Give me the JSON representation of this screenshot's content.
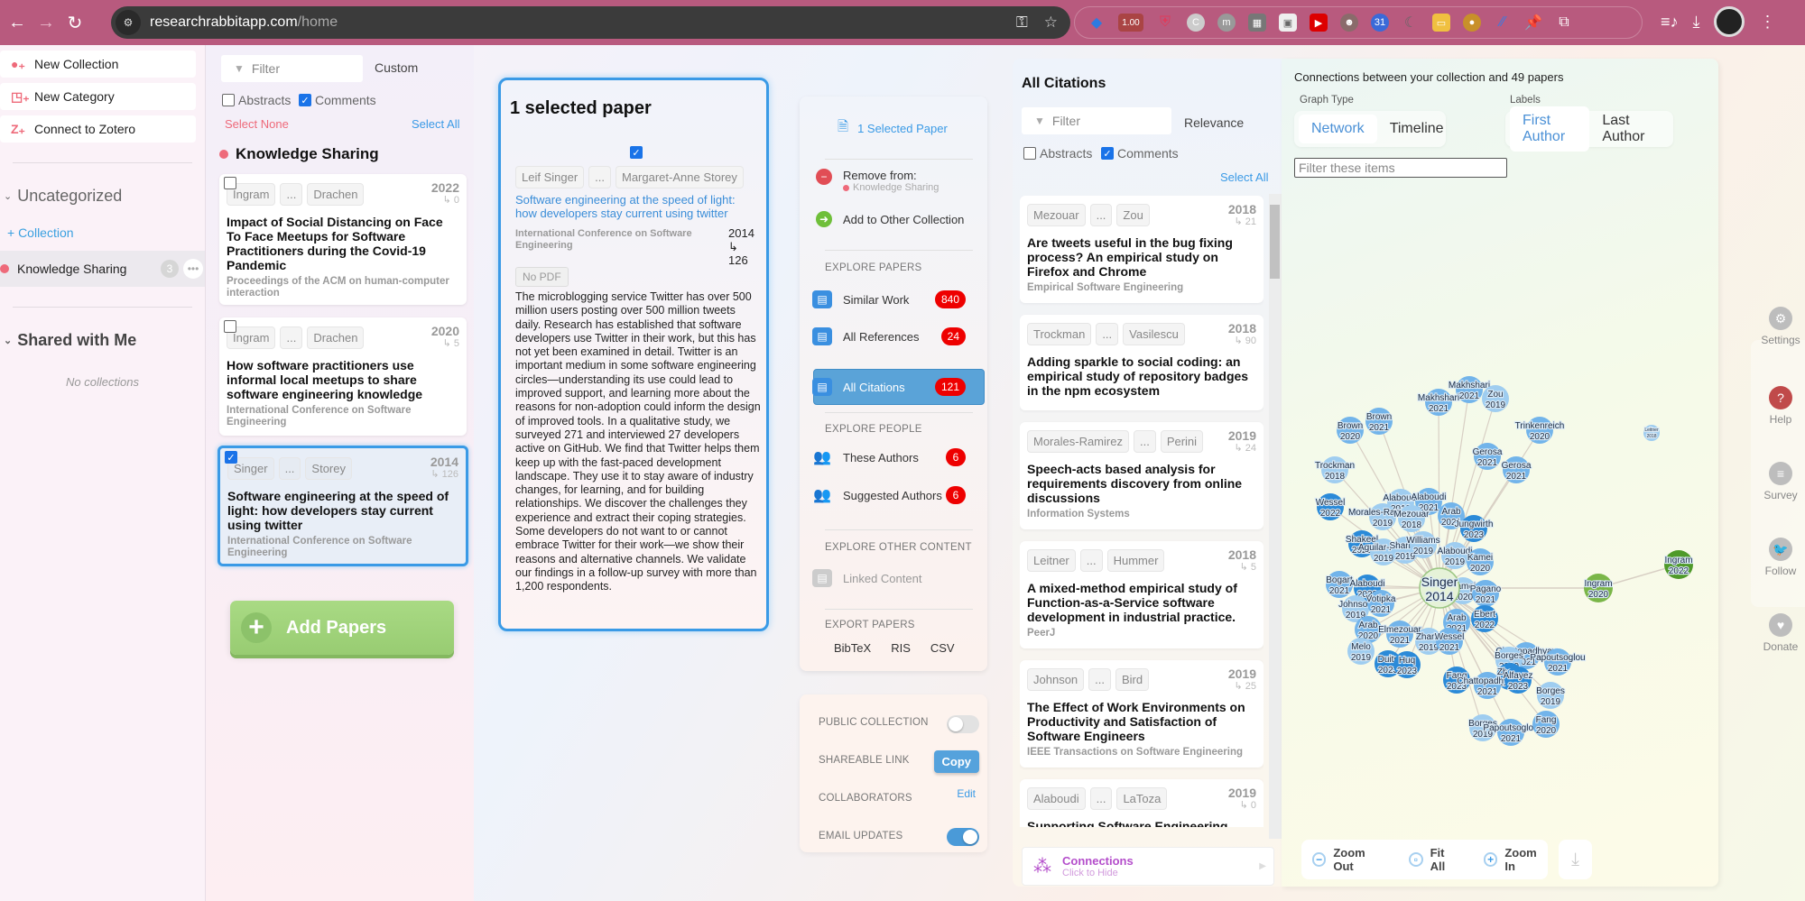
{
  "browser": {
    "url_domain": "researchrabbitapp.com",
    "url_path": "/home",
    "extension_badge": "1.00",
    "extensions": [
      "gem-icon",
      "zoom-badge-icon",
      "shield-icon",
      "c-icon",
      "m-icon",
      "puzzle-icon",
      "window-icon",
      "video-icon",
      "gorilla-icon",
      "calendar-31-icon",
      "moon-icon",
      "folder-icon",
      "cookie-icon",
      "ai-icon",
      "pin-icon",
      "extensions-icon"
    ]
  },
  "sidebar": {
    "actions": [
      {
        "label": "New Collection",
        "icon": "new-collection-icon"
      },
      {
        "label": "New Category",
        "icon": "new-category-icon"
      },
      {
        "label": "Connect to Zotero",
        "icon": "zotero-icon"
      }
    ],
    "section_uncategorized": "Uncategorized",
    "add_collection": "+ Collection",
    "collection": {
      "name": "Knowledge Sharing",
      "count": "3",
      "color": "#ee6a7a"
    },
    "section_shared": "Shared with Me",
    "shared_empty": "No collections"
  },
  "collection_column": {
    "filter_placeholder": "Filter",
    "sort": "Custom",
    "abstracts_label": "Abstracts",
    "abstracts_checked": false,
    "comments_label": "Comments",
    "comments_checked": true,
    "select_none": "Select None",
    "select_all": "Select All",
    "title": "Knowledge Sharing",
    "papers": [
      {
        "first_author": "Ingram",
        "last_author": "Drachen",
        "year": "2022",
        "citations": "↳ 0",
        "title": "Impact of Social Distancing on Face To Face Meetups for Software Practitioners during the Covid-19 Pandemic",
        "venue": "Proceedings of the ACM on human-computer interaction",
        "selected": false
      },
      {
        "first_author": "Ingram",
        "last_author": "Drachen",
        "year": "2020",
        "citations": "↳ 5",
        "title": "How software practitioners use informal local meetups to share software engineering knowledge",
        "venue": "International Conference on Software Engineering",
        "selected": false
      },
      {
        "first_author": "Singer",
        "last_author": "Storey",
        "year": "2014",
        "citations": "↳ 126",
        "title": "Software engineering at the speed of light: how developers stay current using twitter",
        "venue": "International Conference on Software Engineering",
        "selected": true
      }
    ],
    "add_papers": "Add Papers"
  },
  "selected_paper": {
    "heading": "1 selected paper",
    "first_author": "Leif Singer",
    "ellipsis": "...",
    "last_author": "Margaret-Anne Storey",
    "title": "Software engineering at the speed of light: how developers stay current using twitter",
    "venue": "International Conference on Software Engineering",
    "year": "2014",
    "cite_arrow": "↳",
    "citations": "126",
    "pdf": "No PDF",
    "abstract": "The microblogging service Twitter has over 500 million users posting over 500 million tweets daily. Research has established that software developers use Twitter in their work, but this has not yet been examined in detail. Twitter is an important medium in some software engineering circles—understanding its use could lead to improved support, and learning more about the reasons for non-adoption could inform the design of improved tools. In a qualitative study, we surveyed 271 and interviewed 27 developers active on GitHub. We find that Twitter helps them keep up with the fast-paced development landscape. They use it to stay aware of industry changes, for learning, and for building relationships. We discover the challenges they experience and extract their coping strategies. Some developers do not want to or cannot embrace Twitter for their work—we show their reasons and alternative channels. We validate our findings in a follow-up survey with more than 1,200 respondents."
  },
  "action_menu": {
    "selected": "1 Selected Paper",
    "remove_from": "Remove from:",
    "remove_collection": "Knowledge Sharing",
    "add_other": "Add to Other Collection",
    "explore_papers": "EXPLORE PAPERS",
    "similar_work": {
      "label": "Similar Work",
      "count": "840"
    },
    "all_references": {
      "label": "All References",
      "count": "24"
    },
    "all_citations": {
      "label": "All Citations",
      "count": "121"
    },
    "explore_people": "EXPLORE PEOPLE",
    "these_authors": {
      "label": "These Authors",
      "count": "6"
    },
    "suggested_authors": {
      "label": "Suggested Authors",
      "count": "6"
    },
    "explore_other": "EXPLORE OTHER CONTENT",
    "linked_content": "Linked Content",
    "export_papers": "EXPORT PAPERS",
    "export_formats": [
      "BibTeX",
      "RIS",
      "CSV"
    ]
  },
  "collection_settings": {
    "public_collection": "PUBLIC COLLECTION",
    "public_on": false,
    "shareable_link": "SHAREABLE LINK",
    "copy": "Copy",
    "collaborators": "COLLABORATORS",
    "edit": "Edit",
    "email_updates": "EMAIL UPDATES",
    "email_on": true
  },
  "citations": {
    "heading": "All Citations",
    "filter_placeholder": "Filter",
    "sort": "Relevance",
    "abstracts_label": "Abstracts",
    "comments_label": "Comments",
    "select_all": "Select All",
    "papers": [
      {
        "first_author": "Mezouar",
        "last_author": "Zou",
        "year": "2018",
        "citations": "↳ 21",
        "title": "Are tweets useful in the bug fixing process? An empirical study on Firefox and Chrome",
        "venue": "Empirical Software Engineering"
      },
      {
        "first_author": "Trockman",
        "last_author": "Vasilescu",
        "year": "2018",
        "citations": "↳ 90",
        "title": "Adding sparkle to social coding: an empirical study of repository badges in the npm ecosystem",
        "venue": ""
      },
      {
        "first_author": "Morales-Ramirez",
        "last_author": "Perini",
        "year": "2019",
        "citations": "↳ 24",
        "title": "Speech-acts based analysis for requirements discovery from online discussions",
        "venue": "Information Systems"
      },
      {
        "first_author": "Leitner",
        "last_author": "Hummer",
        "year": "2018",
        "citations": "↳ 5",
        "title": "A mixed-method empirical study of Function-as-a-Service software development in industrial practice.",
        "venue": "PeerJ"
      },
      {
        "first_author": "Johnson",
        "last_author": "Bird",
        "year": "2019",
        "citations": "↳ 25",
        "title": "The Effect of Work Environments on Productivity and Satisfaction of Software Engineers",
        "venue": "IEEE Transactions on Software Engineering"
      },
      {
        "first_author": "Alaboudi",
        "last_author": "LaToza",
        "year": "2019",
        "citations": "↳ 0",
        "title": "Supporting Software Engineering Research and Education by",
        "venue": ""
      }
    ],
    "connections_title": "Connections",
    "connections_sub": "Click to Hide"
  },
  "graph": {
    "title": "Connections between your collection and 49 papers",
    "graph_type_label": "Graph Type",
    "graph_types": [
      "Network",
      "Timeline"
    ],
    "graph_type_active": "Network",
    "labels_label": "Labels",
    "label_types": [
      "First Author",
      "Last Author"
    ],
    "label_active": "First Author",
    "filter_placeholder": "Filter these items",
    "zoom_out": "Zoom Out",
    "fit_all": "Fit All",
    "zoom_in": "Zoom In",
    "center": {
      "name": "Singer",
      "year": "2014"
    },
    "nodes": [
      {
        "name": "Makhshari",
        "year": "2021",
        "shade": 1
      },
      {
        "name": "Makhshari",
        "year": "2021",
        "shade": 1
      },
      {
        "name": "Zou",
        "year": "2019",
        "shade": 0
      },
      {
        "name": "Brown",
        "year": "2021",
        "shade": 1
      },
      {
        "name": "Brown",
        "year": "2020",
        "shade": 1
      },
      {
        "name": "Trinkenreich",
        "year": "2020",
        "shade": 1
      },
      {
        "name": "Gerosa",
        "year": "2021",
        "shade": 1
      },
      {
        "name": "Gerosa",
        "year": "2021",
        "shade": 1
      },
      {
        "name": "Trockman",
        "year": "2018",
        "shade": 0
      },
      {
        "name": "Wessel",
        "year": "2022",
        "shade": 2
      },
      {
        "name": "Alaboudi",
        "year": "2019",
        "shade": 0
      },
      {
        "name": "Alaboudi",
        "year": "2021",
        "shade": 1
      },
      {
        "name": "Morales-Ramirez",
        "year": "2019",
        "shade": 0
      },
      {
        "name": "Mezouar",
        "year": "2018",
        "shade": 0
      },
      {
        "name": "Arab",
        "year": "2021",
        "shade": 1
      },
      {
        "name": "Jungwirth",
        "year": "2023",
        "shade": 2
      },
      {
        "name": "Shakeel",
        "year": "2022",
        "shade": 2
      },
      {
        "name": "Aguilar-Avila",
        "year": "2019",
        "shade": 0
      },
      {
        "name": "Sharma",
        "year": "2019",
        "shade": 0
      },
      {
        "name": "Williams",
        "year": "2019",
        "shade": 0
      },
      {
        "name": "Alaboudi",
        "year": "2019",
        "shade": 0
      },
      {
        "name": "Kamei",
        "year": "2020",
        "shade": 1
      },
      {
        "name": "Bogart",
        "year": "2021",
        "shade": 1
      },
      {
        "name": "Alaboudi",
        "year": "2023",
        "shade": 2
      },
      {
        "name": "Kamei",
        "year": "2020",
        "shade": 0
      },
      {
        "name": "Pagano",
        "year": "2021",
        "shade": 1
      },
      {
        "name": "Johnson",
        "year": "2019",
        "shade": 0
      },
      {
        "name": "Votipka",
        "year": "2021",
        "shade": 1
      },
      {
        "name": "Ebert",
        "year": "2022",
        "shade": 2
      },
      {
        "name": "Arab",
        "year": "2020",
        "shade": 1
      },
      {
        "name": "Arab",
        "year": "2021",
        "shade": 1
      },
      {
        "name": "Elmezouar",
        "year": "2021",
        "shade": 1
      },
      {
        "name": "Zhang",
        "year": "2019",
        "shade": 0
      },
      {
        "name": "Wessel",
        "year": "2021",
        "shade": 1
      },
      {
        "name": "Melo",
        "year": "2019",
        "shade": 0
      },
      {
        "name": "Chattopadhyay",
        "year": "2021",
        "shade": 1
      },
      {
        "name": "Duits",
        "year": "2023",
        "shade": 2
      },
      {
        "name": "Huq",
        "year": "2023",
        "shade": 2
      },
      {
        "name": "Borges",
        "year": "2019",
        "shade": 0
      },
      {
        "name": "Papoutsoglou",
        "year": "2021",
        "shade": 1
      },
      {
        "name": "Zhang",
        "year": "2022",
        "shade": 2
      },
      {
        "name": "Fang",
        "year": "2023",
        "shade": 2
      },
      {
        "name": "Chattopadhyay",
        "year": "2021",
        "shade": 1
      },
      {
        "name": "Alfayez",
        "year": "2023",
        "shade": 2
      },
      {
        "name": "Borges",
        "year": "2019",
        "shade": 0
      },
      {
        "name": "Borges",
        "year": "2019",
        "shade": 0
      },
      {
        "name": "Papoutsoglou",
        "year": "2021",
        "shade": 1
      },
      {
        "name": "Fang",
        "year": "2020",
        "shade": 1
      },
      {
        "name": "Leitner",
        "year": "2018",
        "shade": 0
      }
    ],
    "collection_nodes": [
      {
        "name": "Ingram",
        "year": "2020"
      },
      {
        "name": "Ingram",
        "year": "2022"
      }
    ]
  },
  "right_rail": {
    "settings": "Settings",
    "help": "Help",
    "survey": "Survey",
    "follow": "Follow",
    "donate": "Donate"
  }
}
